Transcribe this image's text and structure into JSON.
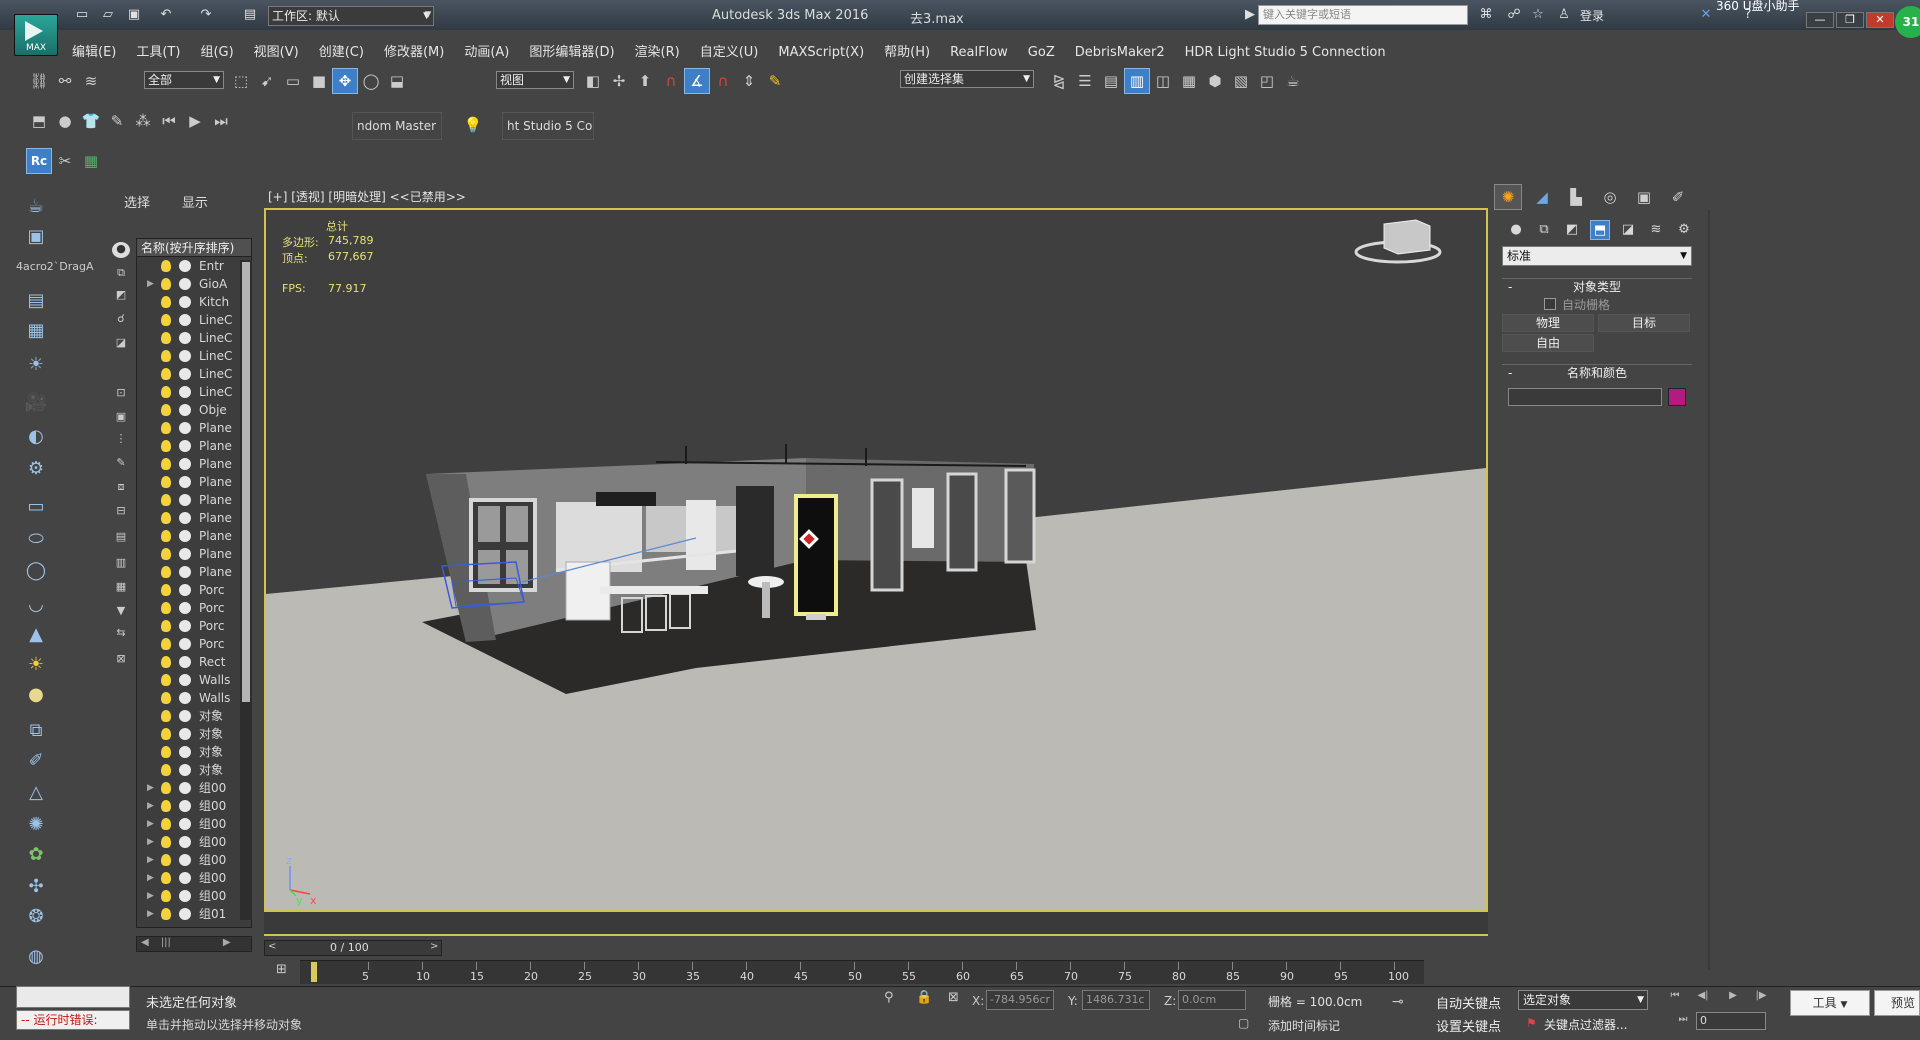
{
  "window": {
    "app_title": "Autodesk 3ds Max 2016",
    "file_name": "去3.max",
    "logo_text": "MAX",
    "workspace": "工作区: 默认",
    "search_placeholder": "键入关键字或短语",
    "login": "登录",
    "sys_tray": "360 U盘小助手",
    "badge": "31"
  },
  "menu": [
    "编辑(E)",
    "工具(T)",
    "组(G)",
    "视图(V)",
    "创建(C)",
    "修改器(M)",
    "动画(A)",
    "图形编辑器(D)",
    "渲染(R)",
    "自定义(U)",
    "MAXScript(X)",
    "帮助(H)",
    "RealFlow",
    "GoZ",
    "DebrisMaker2",
    "HDR Light Studio 5 Connection"
  ],
  "toolbar": {
    "selection_filter": "全部",
    "ref_coord": "视图",
    "named_sel_set": "创建选择集",
    "plugin1": "ndom Master",
    "plugin2": "ht Studio 5 Co"
  },
  "left_panel": {
    "macro_label": "4acro2`DragA"
  },
  "scene_explorer": {
    "tab_select": "选择",
    "tab_display": "显示",
    "header": "名称(按升序排序)",
    "rows": [
      {
        "label": "Entr",
        "expand": ""
      },
      {
        "label": "GioA",
        "expand": "▶"
      },
      {
        "label": "Kitch",
        "expand": ""
      },
      {
        "label": "LineC",
        "expand": ""
      },
      {
        "label": "LineC",
        "expand": ""
      },
      {
        "label": "LineC",
        "expand": ""
      },
      {
        "label": "LineC",
        "expand": ""
      },
      {
        "label": "LineC",
        "expand": ""
      },
      {
        "label": "Obje",
        "expand": ""
      },
      {
        "label": "Plane",
        "expand": ""
      },
      {
        "label": "Plane",
        "expand": ""
      },
      {
        "label": "Plane",
        "expand": ""
      },
      {
        "label": "Plane",
        "expand": ""
      },
      {
        "label": "Plane",
        "expand": ""
      },
      {
        "label": "Plane",
        "expand": ""
      },
      {
        "label": "Plane",
        "expand": ""
      },
      {
        "label": "Plane",
        "expand": ""
      },
      {
        "label": "Plane",
        "expand": ""
      },
      {
        "label": "Porc",
        "expand": ""
      },
      {
        "label": "Porc",
        "expand": ""
      },
      {
        "label": "Porc",
        "expand": ""
      },
      {
        "label": "Porc",
        "expand": ""
      },
      {
        "label": "Rect",
        "expand": ""
      },
      {
        "label": "Walls",
        "expand": ""
      },
      {
        "label": "Walls",
        "expand": ""
      },
      {
        "label": "对象",
        "expand": ""
      },
      {
        "label": "对象",
        "expand": ""
      },
      {
        "label": "对象",
        "expand": ""
      },
      {
        "label": "对象",
        "expand": ""
      },
      {
        "label": "组00",
        "expand": "▶"
      },
      {
        "label": "组00",
        "expand": "▶"
      },
      {
        "label": "组00",
        "expand": "▶"
      },
      {
        "label": "组00",
        "expand": "▶"
      },
      {
        "label": "组00",
        "expand": "▶"
      },
      {
        "label": "组00",
        "expand": "▶"
      },
      {
        "label": "组00",
        "expand": "▶"
      },
      {
        "label": "组01",
        "expand": "▶"
      }
    ]
  },
  "viewport": {
    "label": "[+] [透视] [明暗处理] <<已禁用>>",
    "stats_title": "总计",
    "polys_label": "多边形:",
    "polys_value": "745,789",
    "verts_label": "顶点:",
    "verts_value": "677,667",
    "fps_label": "FPS:",
    "fps_value": "77.917",
    "axis_x": "x",
    "axis_y": "y",
    "axis_z": "z"
  },
  "command_panel": {
    "dropdown": "标准",
    "rollout_object_type": "对象类型",
    "autogrid": "自动栅格",
    "btn_physical": "物理",
    "btn_target": "目标",
    "btn_free": "自由",
    "rollout_name_color": "名称和颜色",
    "swatch_color": "#b31b80"
  },
  "timeline": {
    "frame_label": "0 / 100",
    "ticks": [
      5,
      10,
      15,
      20,
      25,
      30,
      35,
      40,
      45,
      50,
      55,
      60,
      65,
      70,
      75,
      80,
      85,
      90,
      95,
      100
    ],
    "min": 0,
    "max": 100,
    "current": 0
  },
  "status": {
    "main": "未选定任何对象",
    "hint": "单击并拖动以选择并移动对象",
    "error": "-- 运行时错误:",
    "x_label": "X:",
    "x_value": "-784.956cr",
    "y_label": "Y:",
    "y_value": "1486.731c",
    "z_label": "Z:",
    "z_value": "0.0cm",
    "grid": "栅格 = 100.0cm",
    "add_time_tag": "添加时间标记",
    "auto_key": "自动关键点",
    "set_key": "设置关键点",
    "selected_object": "选定对象",
    "key_filters": "关键点过滤器...",
    "current_frame": "0",
    "tools": "工具",
    "preview": "预览"
  }
}
